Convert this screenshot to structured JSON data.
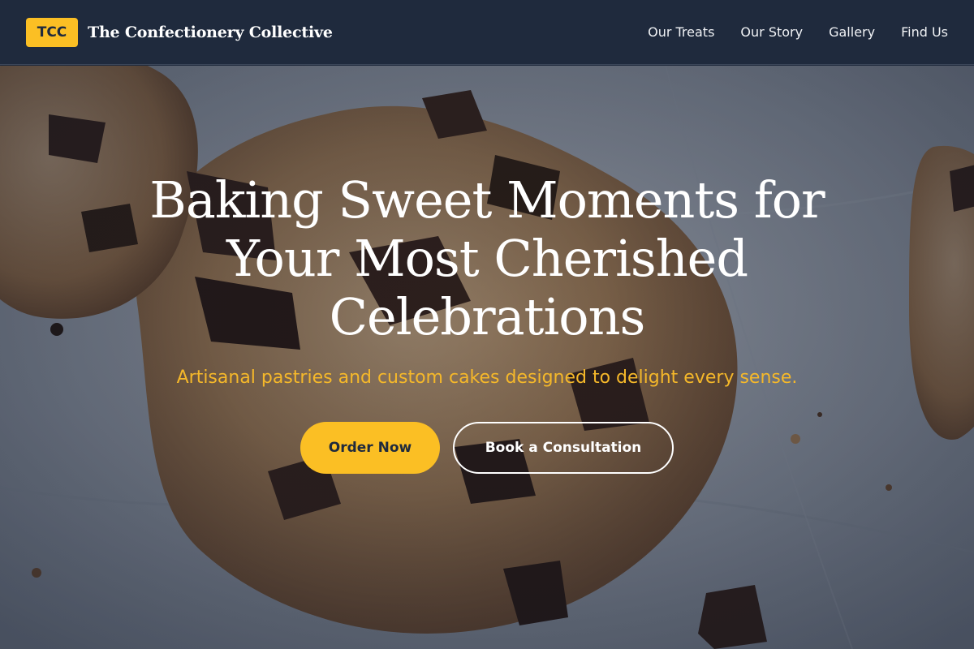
{
  "colors": {
    "accent": "#fbbf24",
    "header_bg": "#1f2a3d",
    "subtitle": "#f5b82a"
  },
  "header": {
    "logo_text": "TCC",
    "brand_name": "The Confectionery Collective",
    "nav": [
      {
        "label": "Our Treats"
      },
      {
        "label": "Our Story"
      },
      {
        "label": "Gallery"
      },
      {
        "label": "Find Us"
      }
    ]
  },
  "hero": {
    "background_image": "chocolate-chip-cookies-photo",
    "title": "Baking Sweet Moments for Your Most Cherished Celebrations",
    "subtitle": "Artisanal pastries and custom cakes designed to delight every sense.",
    "primary_cta": "Order Now",
    "secondary_cta": "Book a Consultation"
  }
}
